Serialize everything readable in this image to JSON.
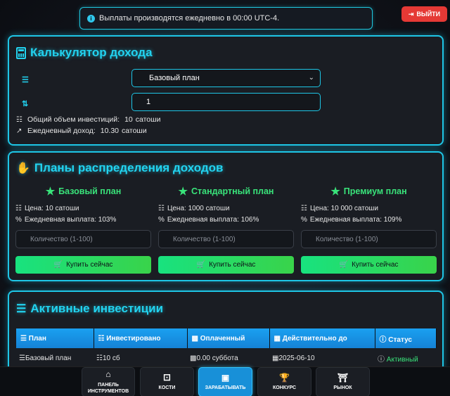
{
  "notice": {
    "text": "Выплаты производятся ежедневно в 00:00 UTC-4."
  },
  "logout": {
    "label": "ВЫЙТИ"
  },
  "calculator": {
    "title": "Калькулятор дохода",
    "plan_selected": "Базовый план",
    "quantity": "1",
    "total_label": "Общий объем инвестиций:",
    "total_value": "10",
    "total_unit": "сатоши",
    "daily_label": "Ежедневный доход:",
    "daily_value": "10.30",
    "daily_unit": "сатоши"
  },
  "plans": {
    "title": "Планы распределения доходов",
    "items": [
      {
        "name": "Базовый план",
        "price": "Цена: 10 сатоши",
        "payout": "Ежедневная выплата: 103%",
        "qty_placeholder": "Количество (1-100)",
        "buy_label": "Купить сейчас"
      },
      {
        "name": "Стандартный план",
        "price": "Цена: 1000 сатоши",
        "payout": "Ежедневная выплата: 106%",
        "qty_placeholder": "Количество (1-100)",
        "buy_label": "Купить сейчас"
      },
      {
        "name": "Премиум план",
        "price": "Цена: 10 000 сатоши",
        "payout": "Ежедневная выплата: 109%",
        "qty_placeholder": "Количество (1-100)",
        "buy_label": "Купить сейчас"
      }
    ]
  },
  "investments": {
    "title": "Активные инвестиции",
    "headers": [
      "План",
      "Инвестировано",
      "Оплаченный",
      "Действительно до",
      "Статус"
    ],
    "rows": [
      {
        "plan": "Базовый план",
        "invested": "10 сб",
        "paid": "0.00 суббота",
        "valid_until": "2025-06-10",
        "status": "Активный"
      }
    ]
  },
  "nav": [
    {
      "label": "ПАНЕЛЬ ИНСТРУМЕНТОВ"
    },
    {
      "label": "КОСТИ"
    },
    {
      "label": "ЗАРАБАТЫВАТЬ"
    },
    {
      "label": "КОНКУРС"
    },
    {
      "label": "РЫНОК"
    }
  ],
  "colors": {
    "accent": "#1ec6e6",
    "green": "#39e37a",
    "danger": "#e53935",
    "table_header": "#1a90e0"
  }
}
